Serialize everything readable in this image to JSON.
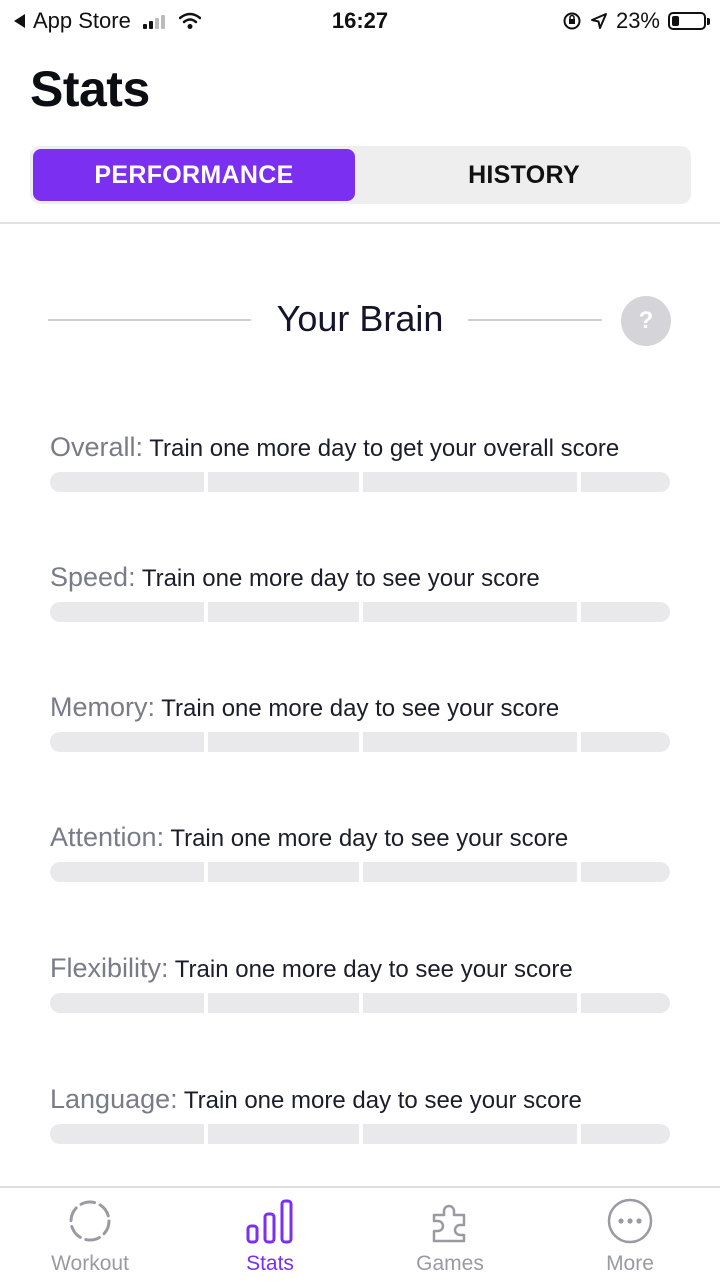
{
  "status_bar": {
    "back_label": "App Store",
    "time": "16:27",
    "battery": "23%",
    "battery_level": 0.23
  },
  "page": {
    "title": "Stats"
  },
  "segmented_control": {
    "performance_label": "PERFORMANCE",
    "history_label": "HISTORY",
    "selected": "PERFORMANCE",
    "accent_color": "#7b2ff0"
  },
  "section": {
    "title": "Your Brain",
    "help_label": "?"
  },
  "scores": [
    {
      "label": "Overall:",
      "text": "Train one more day to get your overall score"
    },
    {
      "label": "Speed:",
      "text": "Train one more day to see your score"
    },
    {
      "label": "Memory:",
      "text": "Train one more day to see your score"
    },
    {
      "label": "Attention:",
      "text": "Train one more day to see your score"
    },
    {
      "label": "Flexibility:",
      "text": "Train one more day to see your score"
    },
    {
      "label": "Language:",
      "text": "Train one more day to see your score"
    }
  ],
  "tabs": [
    {
      "label": "Workout",
      "icon": "dashed-circle-icon",
      "active": false
    },
    {
      "label": "Stats",
      "icon": "bar-chart-icon",
      "active": true
    },
    {
      "label": "Games",
      "icon": "puzzle-piece-icon",
      "active": false
    },
    {
      "label": "More",
      "icon": "more-dots-icon",
      "active": false
    }
  ]
}
